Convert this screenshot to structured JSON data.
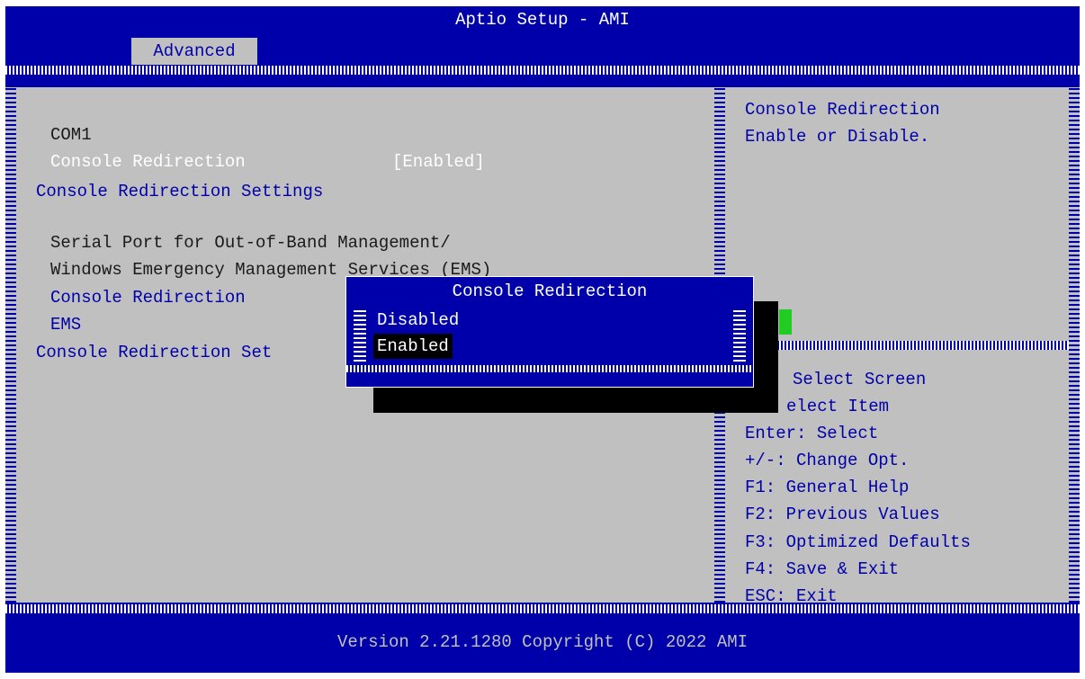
{
  "header": {
    "title": "Aptio Setup - AMI",
    "tab": "Advanced"
  },
  "settings": {
    "com_label": "COM1",
    "console_redirection": {
      "label": "Console Redirection",
      "value": "[Enabled]"
    },
    "console_redirection_settings": "Console Redirection Settings",
    "oob_line1": "Serial Port for Out-of-Band Management/",
    "oob_line2": "Windows Emergency Management Services (EMS)",
    "ems_console_redirection": "Console Redirection",
    "ems_label": "EMS",
    "ems_redirection_settings": "Console Redirection Set"
  },
  "help": {
    "line1": "Console Redirection",
    "line2": "Enable or Disable.",
    "keys": [
      "Select Screen",
      "elect Item",
      "Enter: Select",
      "+/-: Change Opt.",
      "F1: General Help",
      "F2: Previous Values",
      "F3: Optimized Defaults",
      "F4: Save & Exit",
      "ESC: Exit"
    ]
  },
  "popup": {
    "title": "Console Redirection",
    "options": [
      "Disabled",
      "Enabled"
    ],
    "selected": "Enabled"
  },
  "footer": "Version 2.21.1280 Copyright (C) 2022 AMI",
  "colors": {
    "background_blue": "#0000aa",
    "panel_gray": "#c0c0c0",
    "selected_bg": "#000000",
    "cursor_green": "#22cc22"
  }
}
